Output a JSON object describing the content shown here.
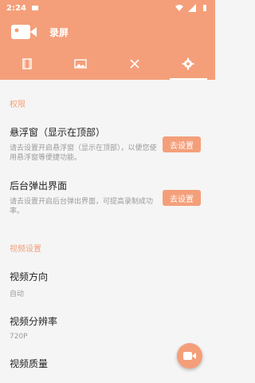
{
  "statusbar": {
    "time": "2:24"
  },
  "app": {
    "title": "录屏"
  },
  "tabs": [
    {
      "icon": "video-icon"
    },
    {
      "icon": "image-icon"
    },
    {
      "icon": "tools-icon"
    },
    {
      "icon": "gear-icon"
    }
  ],
  "sections": {
    "permissions": "权限",
    "video": "视频设置"
  },
  "permissions": [
    {
      "title": "悬浮窗（显示在顶部）",
      "desc": "请去设置开启悬浮窗（显示在顶部），以便您使用悬浮窗等便捷功能。",
      "button": "去设置"
    },
    {
      "title": "后台弹出界面",
      "desc": "请去设置开启后台弹出界面，可提高录制成功率。",
      "button": "去设置"
    }
  ],
  "video_settings": [
    {
      "title": "视频方向",
      "value": "自动"
    },
    {
      "title": "视频分辨率",
      "value": "720P"
    },
    {
      "title": "视频质量",
      "value": ""
    }
  ],
  "colors": {
    "accent": "#f49f7a",
    "background": "#f5f5f5"
  }
}
